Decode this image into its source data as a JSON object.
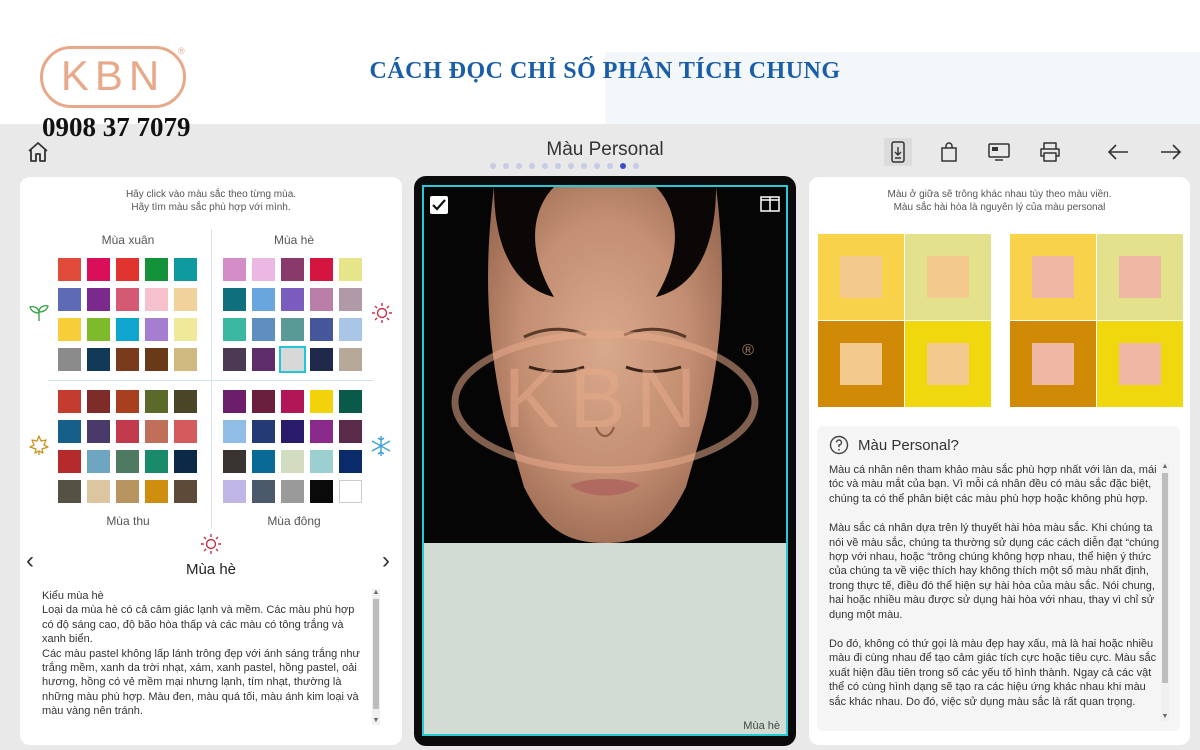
{
  "banner": {
    "logo_text": "KBN",
    "logo_reg": "®",
    "phone": "0908 37 7079",
    "title": "CÁCH ĐỌC CHỈ SỐ PHÂN TÍCH CHUNG"
  },
  "toolbar": {
    "page_title": "Màu Personal",
    "dots_count": 12,
    "active_dot_index": 10
  },
  "left": {
    "hint_line1": "Hãy click vào màu sắc theo từng mùa.",
    "hint_line2": "Hãy tìm màu sắc phù hợp với mình.",
    "spring_label": "Mùa xuân",
    "summer_label": "Mùa hè",
    "autumn_label": "Mùa thu",
    "winter_label": "Mùa đông",
    "selected_season": "Mùa hè",
    "prev_arrow": "‹",
    "next_arrow": "›",
    "description": [
      "Kiểu mùa hè",
      "Loại da mùa hè có cả cảm giác lạnh và mềm. Các màu phù hợp có độ sáng cao, độ bão hòa thấp và các màu có tông trắng và xanh biển.",
      "Các màu pastel không lấp lánh trông đẹp với ánh sáng trắng như trắng mềm, xanh da trời nhạt, xám, xanh pastel, hồng pastel, oải hương, hồng có vẻ mềm mại nhưng lạnh, tím nhạt, thường là những màu phù hợp. Màu đen, màu quá tối, màu ánh kim loại và màu vàng nên tránh."
    ],
    "spring_colors": [
      "#e04b3a",
      "#d90f5a",
      "#e2342f",
      "#13923a",
      "#0f9aa0",
      "#5d6ab6",
      "#7b2a8c",
      "#d45a73",
      "#f4c1cc",
      "#f0d29a",
      "#f6ce3a",
      "#7dbb2c",
      "#0ea6cf",
      "#a67ed0",
      "#f0e999",
      "#8b8b8b",
      "#113a57",
      "#7a3a1c",
      "#6a3a18",
      "#d0b97e"
    ],
    "summer_colors": [
      "#d58dc8",
      "#eab8e0",
      "#8a3a6a",
      "#d3153f",
      "#e6e58a",
      "#0f6f7c",
      "#6aa6de",
      "#7a5cbf",
      "#b97fa8",
      "#b09aa8",
      "#3bb8a1",
      "#5f8fc0",
      "#5a9a96",
      "#46569a",
      "#a9c6e6",
      "#4c3a55",
      "#5f2e6a",
      "#d8d8d8",
      "#1f2a4a",
      "#b6a99a"
    ],
    "autumn_colors": [
      "#c43c30",
      "#7e2b2a",
      "#a8401f",
      "#5a6a2a",
      "#4a4526",
      "#155f8a",
      "#4a3a6a",
      "#c23a4e",
      "#bf6f5a",
      "#d45a5e",
      "#b52a2a",
      "#6ea6c2",
      "#4f7a62",
      "#1a8b6a",
      "#0b2a48",
      "#565145",
      "#dcc6a0",
      "#b89460",
      "#cf8e0f",
      "#5d4a38"
    ],
    "winter_colors": [
      "#6b1f6a",
      "#6a1f3c",
      "#b01556",
      "#f2d20a",
      "#0a5a4a",
      "#8fbde6",
      "#233a72",
      "#2a1a6a",
      "#8a2a8a",
      "#5a2a4a",
      "#3a3430",
      "#0a6a96",
      "#d2dcc0",
      "#9ccfcf",
      "#0a2a6a",
      "#c0b6e6",
      "#4a5a6a",
      "#9a9a9a",
      "#0a0a0a",
      "#ffffff"
    ],
    "selected_swatch": "summer-17"
  },
  "center": {
    "fill_color": "#d2dcd3",
    "fill_label": "Mùa hè",
    "watermark_text": "KBN",
    "watermark_reg": "®"
  },
  "right": {
    "hint_line1": "Màu ở giữa sẽ trông khác nhau tùy theo màu viền.",
    "hint_line2": "Màu sắc hài hòa là nguyên lý của màu personal",
    "demo_left": [
      {
        "outer": "#f9d24c",
        "inner": "#f3c98e"
      },
      {
        "outer": "#e3e18b",
        "inner": "#f3c98e"
      },
      {
        "outer": "#d08a06",
        "inner": "#f3c98e"
      },
      {
        "outer": "#f0d80f",
        "inner": "#f3c98e"
      }
    ],
    "demo_right": [
      {
        "outer": "#f9d24c",
        "inner": "#f0b8a4"
      },
      {
        "outer": "#e3e18b",
        "inner": "#f0b8a4"
      },
      {
        "outer": "#d08a06",
        "inner": "#f0b8a4"
      },
      {
        "outer": "#f0d80f",
        "inner": "#f0b8a4"
      }
    ],
    "info_title": "Màu Personal?",
    "info_paragraphs": [
      "Màu cá nhân nên tham khảo màu sắc phù hợp nhất với làn da, mái tóc và màu mắt của bạn. Vì mỗi cá nhân đều có màu sắc đặc biệt, chúng ta có thể phân biệt các màu phù hợp  hoặc không phù hợp.",
      "Màu sắc cá nhân dựa trên lý thuyết hài hòa màu sắc. Khi chúng ta nói về màu sắc, chúng ta thường sử dụng các cách diễn đạt “chúng hợp với nhau, hoặc “trông chúng không hợp nhau, thể hiện ý thức của chúng ta về việc thích hay không thích một số màu nhất định, trong thực tế, điều đó thể hiện sự hài hòa của màu sắc. Nói chung, hai hoặc nhiều màu được sử dụng hài hòa với nhau, thay vì chỉ sử dụng một màu.",
      "Do đó, không có thứ gọi là màu đẹp hay xấu, mà là hai hoặc nhiều màu đi cùng nhau để tạo cảm giác tích cực hoặc tiêu cực. Màu sắc xuất hiện đầu tiên trong số các yếu tố hình thành. Ngay cả các vật thể có cùng hình dạng sẽ tạo ra các hiệu ứng khác nhau khi màu sắc khác nhau. Do đó, việc sử dụng màu sắc là rất quan trọng."
    ]
  }
}
